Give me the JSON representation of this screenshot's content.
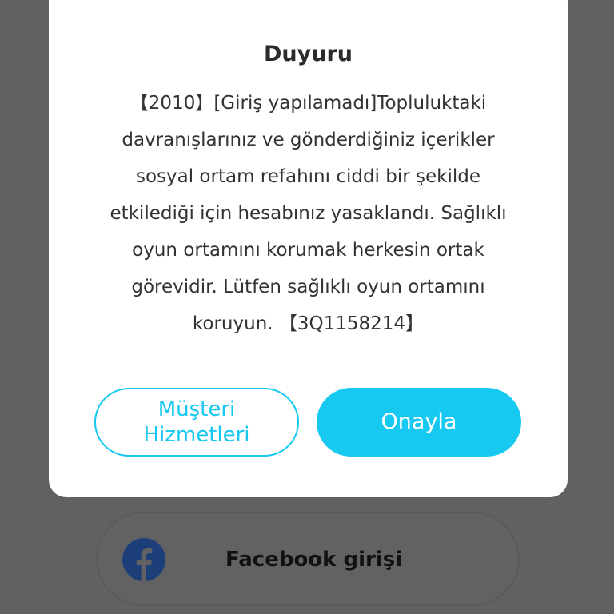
{
  "dialog": {
    "title": "Duyuru",
    "message": "【2010】[Giriş yapılamadı]Topluluktaki\ndavranışlarınız ve gönderdiğiniz içerikler\nsosyal ortam refahını ciddi bir şekilde\netkilediği için hesabınız yasaklandı. Sağlıklı\noyun ortamını korumak herkesin ortak\ngörevidir. Lütfen sağlıklı oyun ortamını\nkoruyun. 【3Q1158214】",
    "secondary_button_label": "Müşteri\nHizmetleri",
    "primary_button_label": "Onayla"
  },
  "login_options": {
    "facebook_label": "Facebook girişi"
  },
  "colors": {
    "accent": "#17c8f1",
    "backdrop": "#616161",
    "facebook_blue": "#1c3f7a"
  },
  "icons": {
    "facebook": "facebook-icon"
  }
}
